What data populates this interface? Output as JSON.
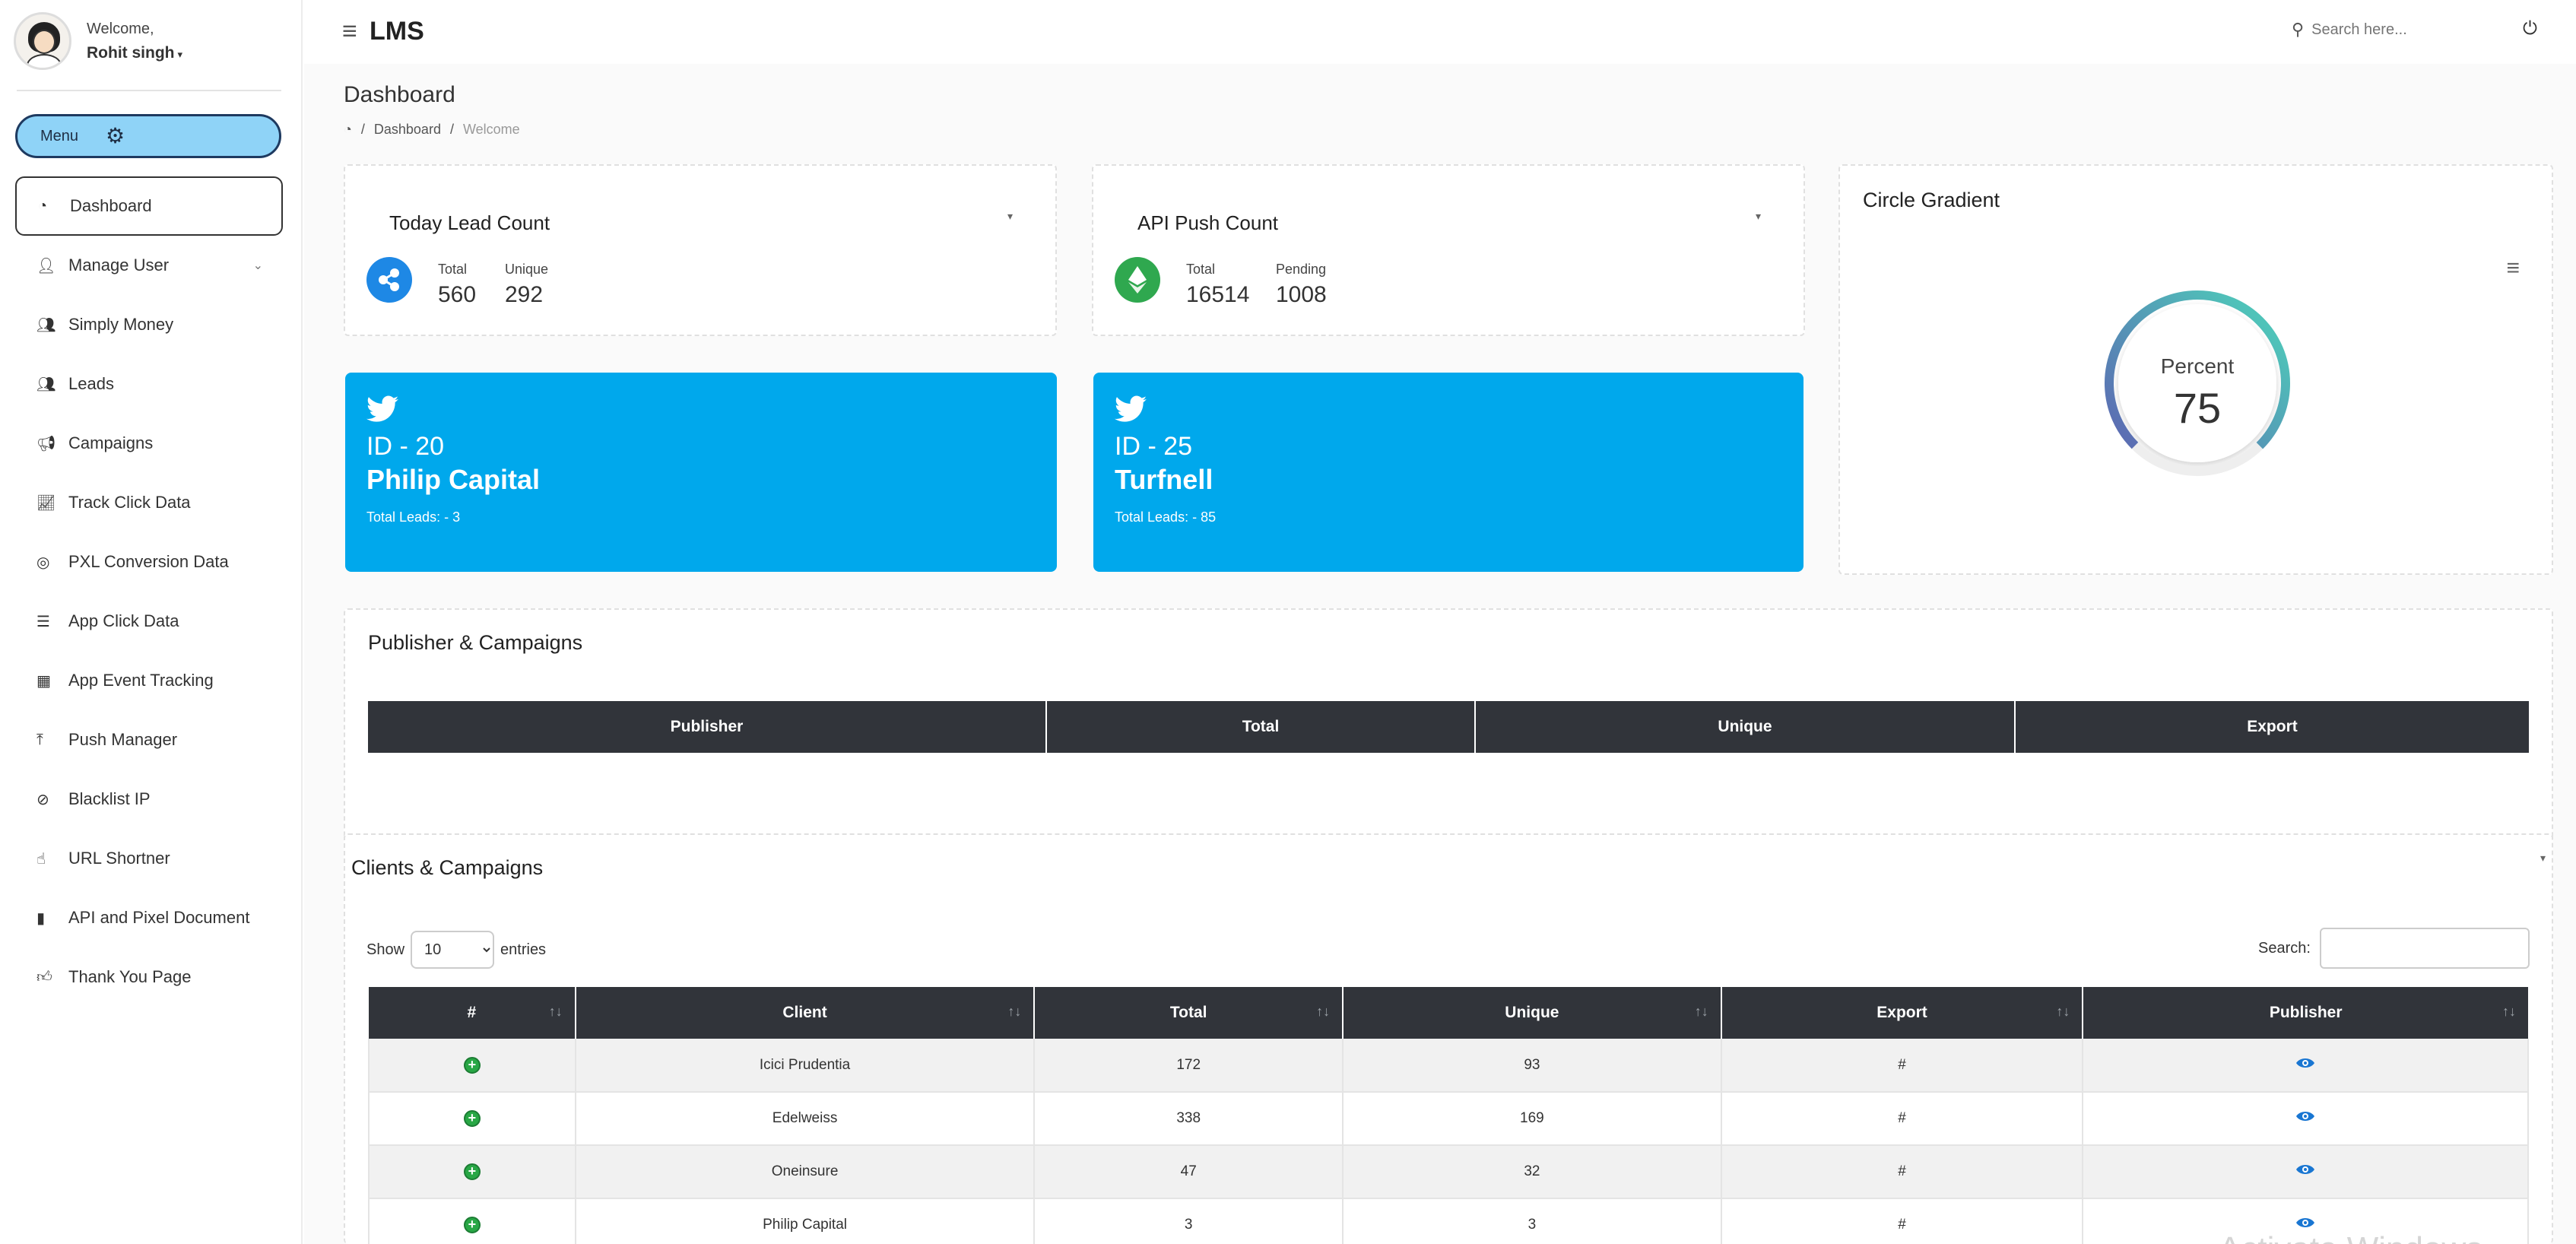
{
  "sidebar": {
    "welcome": "Welcome,",
    "username": "Rohit singh",
    "menu_label": "Menu",
    "items": [
      {
        "label": "Dashboard",
        "icon": "dashboard-icon",
        "active": true
      },
      {
        "label": "Manage User",
        "icon": "user-icon",
        "has_submenu": true
      },
      {
        "label": "Simply Money",
        "icon": "users-icon"
      },
      {
        "label": "Leads",
        "icon": "users-icon"
      },
      {
        "label": "Campaigns",
        "icon": "bullhorn-icon"
      },
      {
        "label": "Track Click Data",
        "icon": "line-chart-icon"
      },
      {
        "label": "PXL Conversion Data",
        "icon": "target-icon"
      },
      {
        "label": "App Click Data",
        "icon": "database-icon"
      },
      {
        "label": "App Event Tracking",
        "icon": "calendar-icon"
      },
      {
        "label": "Push Manager",
        "icon": "upload-icon"
      },
      {
        "label": "Blacklist IP",
        "icon": "ban-icon"
      },
      {
        "label": "URL Shortner",
        "icon": "pointer-icon"
      },
      {
        "label": "API and Pixel Document",
        "icon": "file-icon"
      },
      {
        "label": "Thank You Page",
        "icon": "thumbs-up-icon"
      }
    ]
  },
  "topbar": {
    "brand": "LMS",
    "search_placeholder": "Search here..."
  },
  "page": {
    "title": "Dashboard",
    "breadcrumb": [
      "Dashboard",
      "Welcome"
    ]
  },
  "stats": [
    {
      "title": "Today Lead Count",
      "k1": "Total",
      "v1": "560",
      "k2": "Unique",
      "v2": "292",
      "icon": "ripple-coin-icon",
      "color": "#1e88e5"
    },
    {
      "title": "API Push Count",
      "k1": "Total",
      "v1": "16514",
      "k2": "Pending",
      "v2": "1008",
      "icon": "ethereum-coin-icon",
      "color": "#2fa84f"
    }
  ],
  "twitter_cards": [
    {
      "id": "ID - 20",
      "name": "Philip Capital",
      "leads": "Total Leads: - 3"
    },
    {
      "id": "ID - 25",
      "name": "Turfnell",
      "leads": "Total Leads: - 85"
    }
  ],
  "gauge": {
    "title": "Circle Gradient",
    "label": "Percent",
    "value": "75",
    "percent": 75,
    "colors": [
      "#4fc3b9",
      "#5b6fb3"
    ]
  },
  "publisher_section": {
    "title": "Publisher & Campaigns",
    "headers": [
      "Publisher",
      "Total",
      "Unique",
      "Export"
    ]
  },
  "clients_section": {
    "title": "Clients & Campaigns",
    "show_label": "Show",
    "entries_label": "entries",
    "page_size": "10",
    "search_label": "Search:",
    "headers": [
      "#",
      "Client",
      "Total",
      "Unique",
      "Export",
      "Publisher"
    ],
    "rows": [
      {
        "client": "Icici Prudentia",
        "total": "172",
        "unique": "93",
        "export": "#"
      },
      {
        "client": "Edelweiss",
        "total": "338",
        "unique": "169",
        "export": "#"
      },
      {
        "client": "Oneinsure",
        "total": "47",
        "unique": "32",
        "export": "#"
      },
      {
        "client": "Philip Capital",
        "total": "3",
        "unique": "3",
        "export": "#"
      }
    ]
  },
  "watermark": "Activate Windows"
}
